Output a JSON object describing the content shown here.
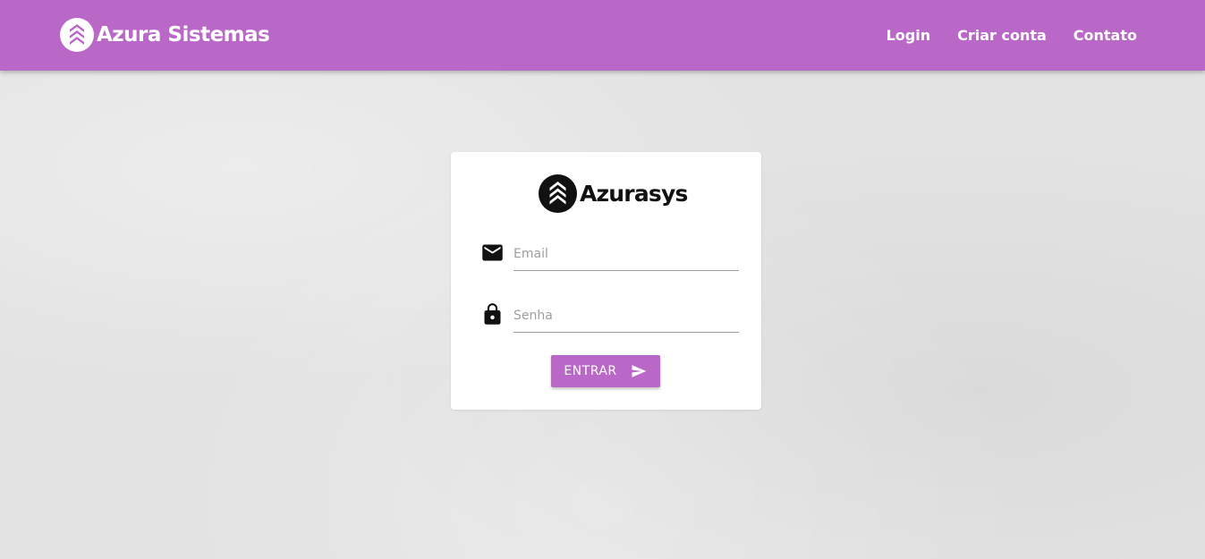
{
  "header": {
    "brand_name": "Azura Sistemas",
    "nav": [
      {
        "label": "Login"
      },
      {
        "label": "Criar conta"
      },
      {
        "label": "Contato"
      }
    ]
  },
  "login_card": {
    "logo_text": "Azurasys",
    "email": {
      "placeholder": "Email",
      "value": "",
      "icon": "email-icon"
    },
    "password": {
      "placeholder": "Senha",
      "value": "",
      "icon": "lock-icon"
    },
    "submit": {
      "label": "ENTRAR",
      "icon": "send-icon"
    }
  },
  "colors": {
    "primary": "#ba68c8",
    "background": "#e3e3e3",
    "card": "#ffffff",
    "logo_dark": "#111111"
  }
}
